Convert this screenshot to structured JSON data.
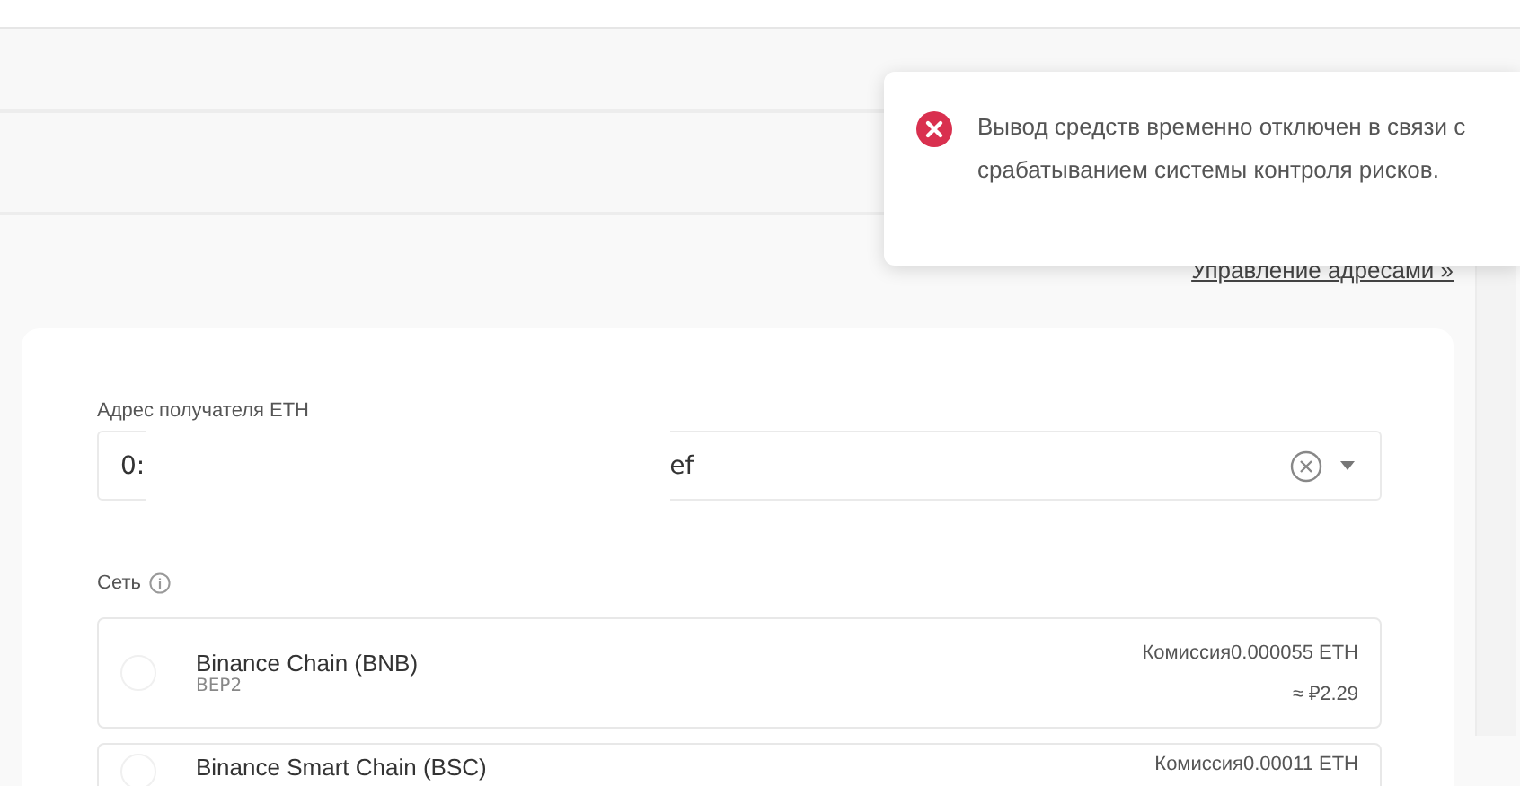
{
  "toast": {
    "kind": "error",
    "message": "Вывод средств временно отключен в связи с срабатыванием системы контроля рисков."
  },
  "manage_link": "Управление адресами »",
  "address_field": {
    "label": "Адрес получателя ETH",
    "value_start": "0:",
    "value_end": "ef"
  },
  "network": {
    "label": "Сеть",
    "options": [
      {
        "name": "Binance Chain (BNB)",
        "subtitle": "BEP2",
        "fee": "Комиссия0.000055 ETH",
        "fee_fiat": "≈ ₽2.29",
        "selected": false
      },
      {
        "name": "Binance Smart Chain (BSC)",
        "fee": "Комиссия0.00011 ETH",
        "selected": false
      }
    ]
  }
}
